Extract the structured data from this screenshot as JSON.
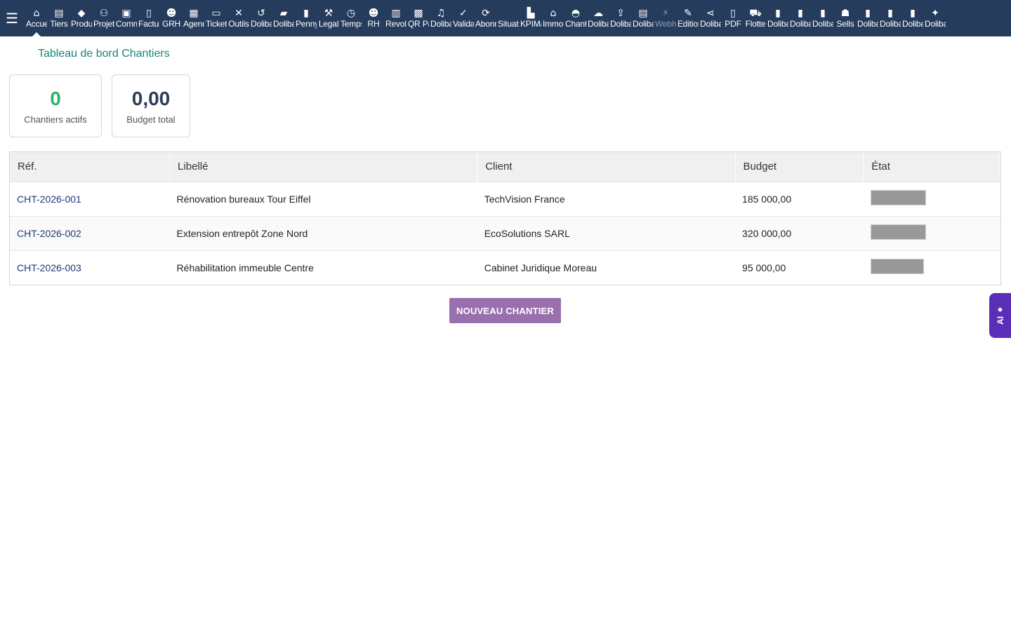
{
  "topbar": {
    "menu_icon": "☰",
    "items": [
      {
        "label": "Accueil",
        "icon": "⌂",
        "name": "home-icon"
      },
      {
        "label": "Tiers",
        "icon": "▤",
        "name": "building-icon"
      },
      {
        "label": "Produits",
        "icon": "◆",
        "name": "cube-icon"
      },
      {
        "label": "Projets",
        "icon": "⚇",
        "name": "sitemap-icon"
      },
      {
        "label": "Commercial",
        "icon": "▣",
        "name": "briefcase-icon"
      },
      {
        "label": "Facturation",
        "icon": "▯",
        "name": "invoice-icon"
      },
      {
        "label": "GRH",
        "icon": "☻",
        "name": "users-icon"
      },
      {
        "label": "Agenda",
        "icon": "▦",
        "name": "calendar-icon"
      },
      {
        "label": "Tickets",
        "icon": "▭",
        "name": "ticket-icon"
      },
      {
        "label": "Outils",
        "icon": "✕",
        "name": "tools-icon"
      },
      {
        "label": "Dolibarr",
        "icon": "↺",
        "name": "undo-icon"
      },
      {
        "label": "Dolibarr",
        "icon": "▰",
        "name": "case-icon"
      },
      {
        "label": "Penny",
        "icon": "▮",
        "name": "file-icon"
      },
      {
        "label": "Legal",
        "icon": "⚒",
        "name": "gavel-icon"
      },
      {
        "label": "Temps",
        "icon": "◷",
        "name": "clock-icon"
      },
      {
        "label": "RH",
        "icon": "☻",
        "name": "people-icon"
      },
      {
        "label": "Revolut",
        "icon": "▥",
        "name": "bank-icon"
      },
      {
        "label": "QR Pay",
        "icon": "▩",
        "name": "qrcode-icon"
      },
      {
        "label": "Dolibarr",
        "icon": "♫",
        "name": "bell-icon"
      },
      {
        "label": "Validation",
        "icon": "✓",
        "name": "check-double-icon"
      },
      {
        "label": "Abonnements",
        "icon": "⟳",
        "name": "sync-icon"
      },
      {
        "label": "Situations",
        "icon": "",
        "name": "blank-icon"
      },
      {
        "label": "KPIMax",
        "icon": "▙",
        "name": "chart-icon"
      },
      {
        "label": "Immobilier",
        "icon": "⌂",
        "name": "house-icon"
      },
      {
        "label": "Chantiers",
        "icon": "◓",
        "name": "hardhat-icon"
      },
      {
        "label": "Dolibarr",
        "icon": "☁",
        "name": "cloud-icon"
      },
      {
        "label": "Dolibarr",
        "icon": "⇪",
        "name": "upload-icon"
      },
      {
        "label": "Dolibarr",
        "icon": "▤",
        "name": "building-alt-icon"
      },
      {
        "label": "Webhooks",
        "icon": "⚡",
        "name": "plug-icon"
      },
      {
        "label": "Edition",
        "icon": "✎",
        "name": "edit-icon"
      },
      {
        "label": "Dolibarr",
        "icon": "⋖",
        "name": "share-icon"
      },
      {
        "label": "PDF",
        "icon": "▯",
        "name": "pdf-icon"
      },
      {
        "label": "Flotte",
        "icon": "⛟",
        "name": "car-icon"
      },
      {
        "label": "Dolibarr",
        "icon": "▮",
        "name": "note-icon"
      },
      {
        "label": "Dolibarr",
        "icon": "▮",
        "name": "note-icon"
      },
      {
        "label": "Dolibarr",
        "icon": "▮",
        "name": "note-icon"
      },
      {
        "label": "Sells",
        "icon": "☗",
        "name": "handshake-icon"
      },
      {
        "label": "Dolibarr",
        "icon": "▮",
        "name": "note-icon"
      },
      {
        "label": "Dolibarr",
        "icon": "▮",
        "name": "note-icon"
      },
      {
        "label": "Dolibarr",
        "icon": "▮",
        "name": "note-icon"
      },
      {
        "label": "Dolibarr",
        "icon": "✦",
        "name": "magic-icon"
      }
    ]
  },
  "dashboard": {
    "title": "Tableau de bord Chantiers",
    "kpis": [
      {
        "value": "0",
        "label": "Chantiers actifs"
      },
      {
        "value": "0,00",
        "label": "Budget total"
      }
    ]
  },
  "table": {
    "headers": [
      "Réf.",
      "Libellé",
      "Client",
      "Budget",
      "État"
    ],
    "rows": [
      {
        "ref": "CHT-2026-001",
        "label": "Rénovation bureaux Tour Eiffel",
        "client": "TechVision France",
        "budget": "185 000,00"
      },
      {
        "ref": "CHT-2026-002",
        "label": "Extension entrepôt Zone Nord",
        "client": "EcoSolutions SARL",
        "budget": "320 000,00"
      },
      {
        "ref": "CHT-2026-003",
        "label": "Réhabilitation immeuble Centre",
        "client": "Cabinet Juridique Moreau",
        "budget": "95 000,00"
      }
    ]
  },
  "actions": {
    "new_button": "NOUVEAU CHANTIER"
  },
  "ai_tab": {
    "icon": "◆",
    "label": "AI"
  }
}
